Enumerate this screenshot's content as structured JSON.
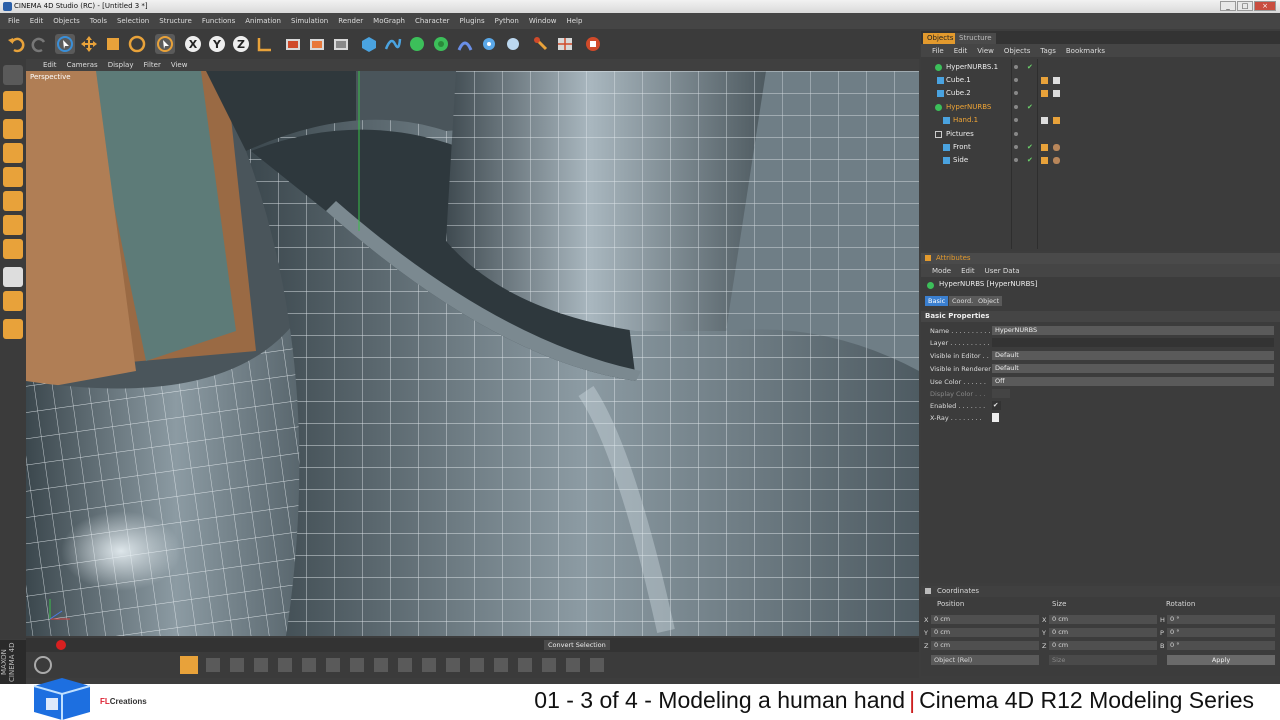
{
  "window": {
    "title": "CINEMA 4D Studio (RC) - [Untitled 3 *]",
    "controls": [
      "_",
      "□",
      "×"
    ]
  },
  "menubar": [
    "File",
    "Edit",
    "Objects",
    "Tools",
    "Selection",
    "Structure",
    "Functions",
    "Animation",
    "Simulation",
    "Render",
    "MoGraph",
    "Character",
    "Plugins",
    "Python",
    "Window",
    "Help"
  ],
  "viewport": {
    "menu": [
      "Edit",
      "Cameras",
      "Display",
      "Filter",
      "View"
    ],
    "label": "Perspective"
  },
  "objects_panel": {
    "tabs": [
      "Objects",
      "Structure"
    ],
    "active_tab": "Objects",
    "menu": [
      "File",
      "Edit",
      "View",
      "Objects",
      "Tags",
      "Bookmarks"
    ],
    "items": [
      {
        "name": "HyperNURBS.1",
        "indent": 0,
        "highlight": false,
        "icon": "hypernurbs-icon"
      },
      {
        "name": "Cube.1",
        "indent": 1,
        "highlight": false,
        "icon": "polygon-icon"
      },
      {
        "name": "Cube.2",
        "indent": 1,
        "highlight": false,
        "icon": "polygon-icon"
      },
      {
        "name": "HyperNURBS",
        "indent": 0,
        "highlight": true,
        "icon": "hypernurbs-icon"
      },
      {
        "name": "Hand.1",
        "indent": 1,
        "highlight": true,
        "icon": "polygon-icon"
      },
      {
        "name": "Pictures",
        "indent": 0,
        "highlight": false,
        "icon": "null-icon"
      },
      {
        "name": "Front",
        "indent": 1,
        "highlight": false,
        "icon": "plane-icon"
      },
      {
        "name": "Side",
        "indent": 1,
        "highlight": false,
        "icon": "plane-icon"
      }
    ]
  },
  "attributes_panel": {
    "title": "Attributes",
    "menu": [
      "Mode",
      "Edit",
      "User Data"
    ],
    "object_header": "HyperNURBS [HyperNURBS]",
    "tabs": [
      "Basic",
      "Coord.",
      "Object"
    ],
    "active_tab": "Basic",
    "section": "Basic Properties",
    "fields": [
      {
        "label": "Name . . . . . . . . . .",
        "value": "HyperNURBS"
      },
      {
        "label": "Layer . . . . . . . . . .",
        "value": ""
      },
      {
        "label": "Visible in Editor . .",
        "value": "Default"
      },
      {
        "label": "Visible in Renderer",
        "value": "Default"
      },
      {
        "label": "Use Color . . . . . .",
        "value": "Off"
      },
      {
        "label": "Display Color . . .",
        "value": ""
      },
      {
        "label": "Enabled . . . . . . .",
        "value": "✔"
      },
      {
        "label": "X-Ray . . . . . . . .",
        "value": ""
      }
    ]
  },
  "coordinates_panel": {
    "title": "Coordinates",
    "headers": [
      "Position",
      "Size",
      "Rotation"
    ],
    "rows": [
      {
        "axis": "X",
        "pos": "0 cm",
        "size_axis": "X",
        "size": "0 cm",
        "rot_axis": "H",
        "rot": "0 °"
      },
      {
        "axis": "Y",
        "pos": "0 cm",
        "size_axis": "Y",
        "size": "0 cm",
        "rot_axis": "P",
        "rot": "0 °"
      },
      {
        "axis": "Z",
        "pos": "0 cm",
        "size_axis": "Z",
        "size": "0 cm",
        "rot_axis": "B",
        "rot": "0 °"
      }
    ],
    "mode_select": "Object (Rel)",
    "size_select": "Size",
    "apply_label": "Apply"
  },
  "timeline": {
    "convert_label": "Convert Selection"
  },
  "maxon_label": "MAXON CINEMA 4D",
  "branding": {
    "fl": "FL",
    "creations": "Creations"
  },
  "caption": {
    "left": "01 - 3 of 4 - Modeling a human hand",
    "separator": "|",
    "right": "Cinema 4D R12 Modeling Series"
  }
}
